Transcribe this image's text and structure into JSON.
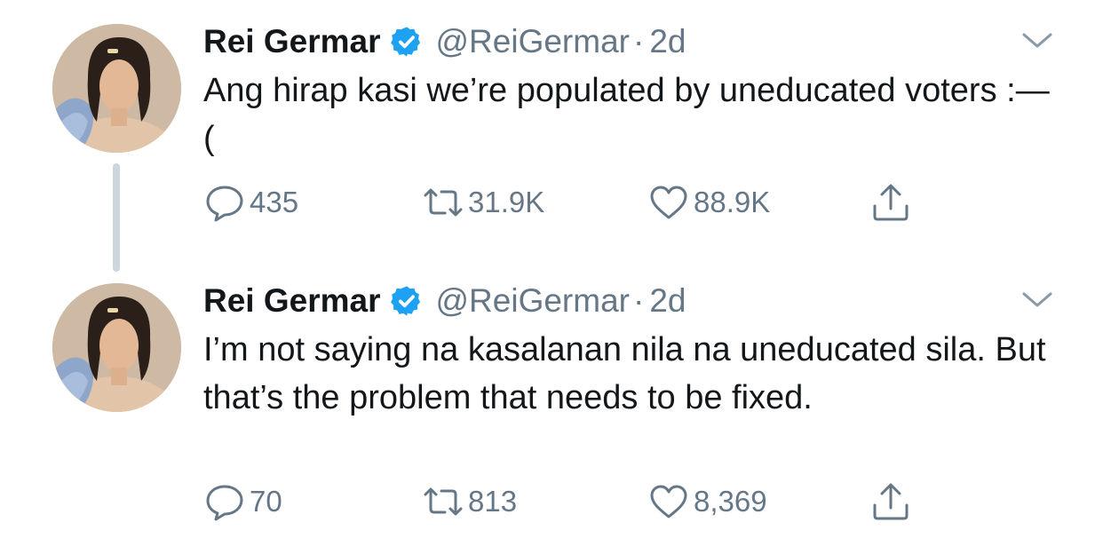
{
  "tweets": [
    {
      "author_name": "Rei Germar",
      "handle": "@ReiGermar",
      "separator": "·",
      "time": "2d",
      "text": "Ang hirap kasi we’re populated by uneducated voters :—(",
      "replies": "435",
      "retweets": "31.9K",
      "likes": "88.9K"
    },
    {
      "author_name": "Rei Germar",
      "handle": "@ReiGermar",
      "separator": "·",
      "time": "2d",
      "text": "I’m not saying na kasalanan nila na uneducated sila. But that’s the problem that needs to be fixed.",
      "replies": "70",
      "retweets": "813",
      "likes": "8,369"
    }
  ],
  "icons": {
    "verified": "verified-badge-icon",
    "menu": "chevron-down-icon",
    "reply": "reply-icon",
    "retweet": "retweet-icon",
    "like": "heart-icon",
    "share": "share-icon"
  },
  "colors": {
    "text": "#14171a",
    "secondary": "#657786",
    "verified": "#1da1f2",
    "thread_line": "#ccd6dd"
  }
}
